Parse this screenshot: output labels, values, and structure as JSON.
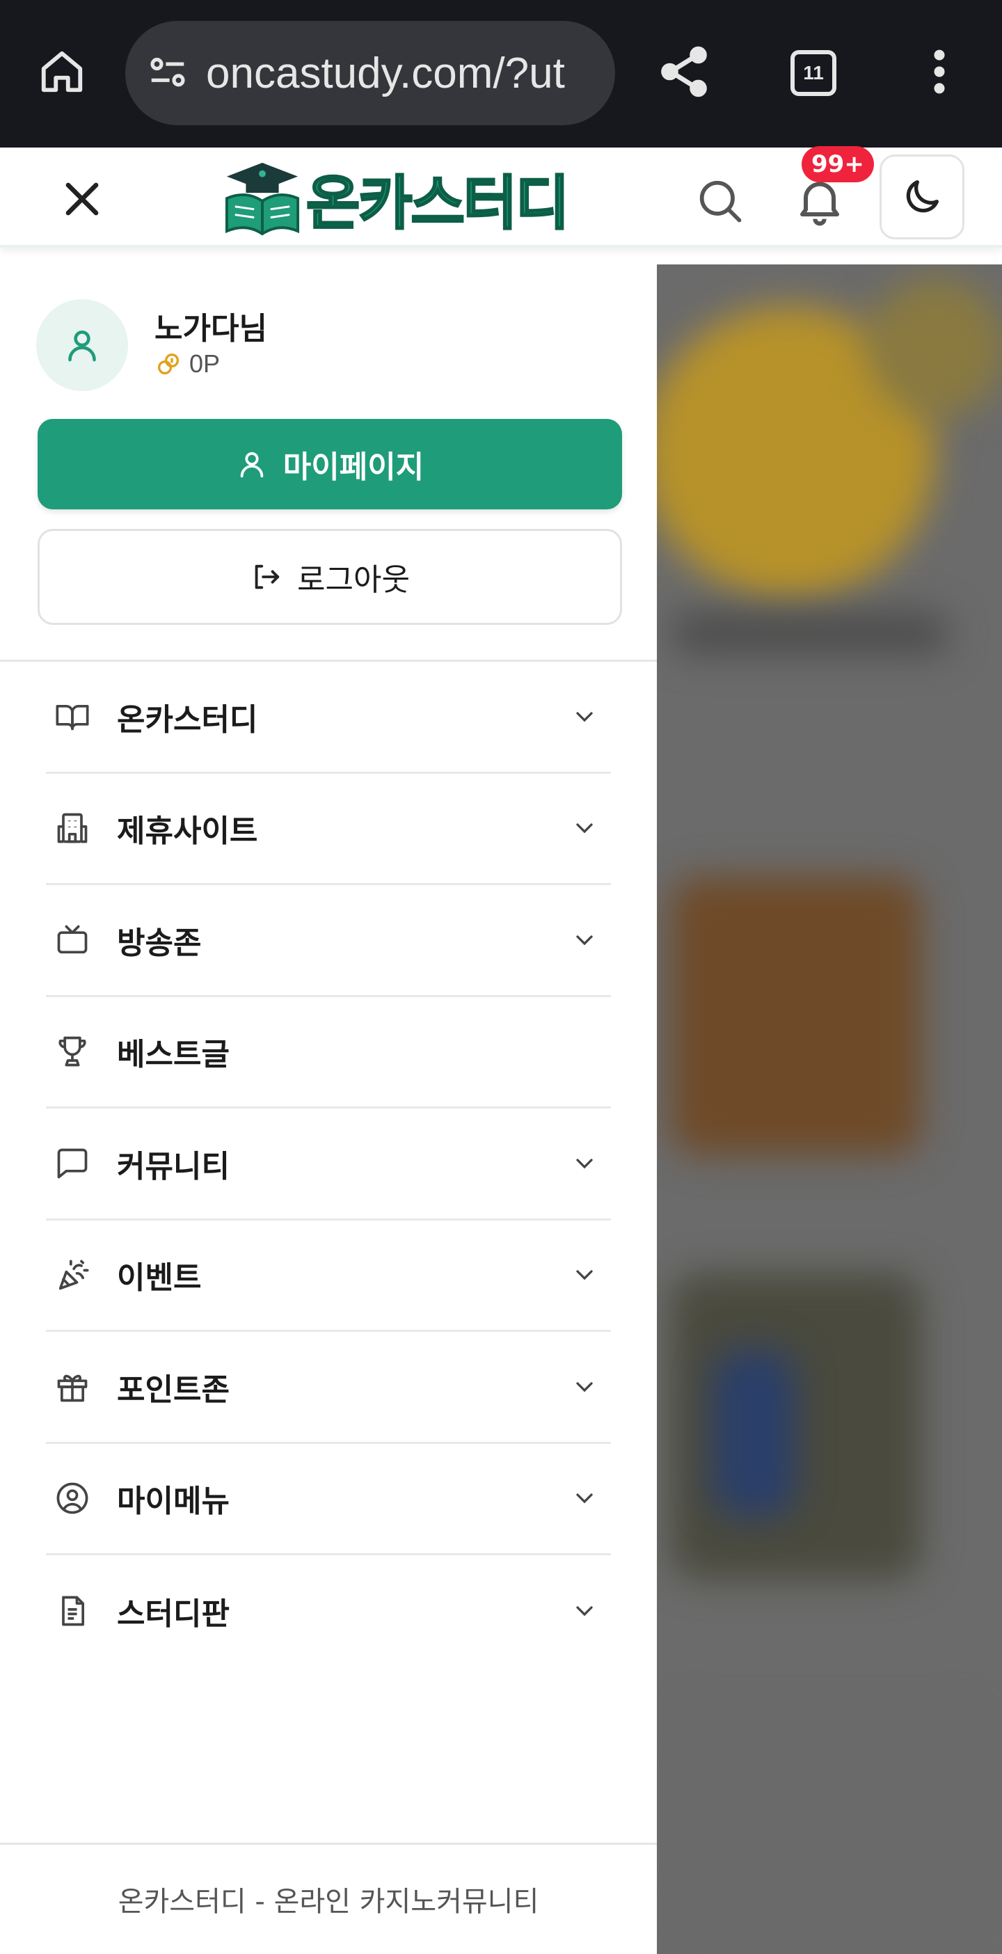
{
  "browser": {
    "url": "oncastudy.com/?ut",
    "tab_count": "11"
  },
  "header": {
    "logo_text": "온카스터디",
    "notification_badge": "99+"
  },
  "drawer": {
    "username": "노가다님",
    "points": "0P",
    "mypage_label": "마이페이지",
    "logout_label": "로그아웃",
    "menu": [
      {
        "label": "온카스터디",
        "icon": "book-icon",
        "expandable": true
      },
      {
        "label": "제휴사이트",
        "icon": "building-icon",
        "expandable": true
      },
      {
        "label": "방송존",
        "icon": "tv-icon",
        "expandable": true
      },
      {
        "label": "베스트글",
        "icon": "trophy-icon",
        "expandable": false
      },
      {
        "label": "커뮤니티",
        "icon": "chat-icon",
        "expandable": true
      },
      {
        "label": "이벤트",
        "icon": "party-popper-icon",
        "expandable": true
      },
      {
        "label": "포인트존",
        "icon": "gift-icon",
        "expandable": true
      },
      {
        "label": "마이메뉴",
        "icon": "user-circle-icon",
        "expandable": true
      },
      {
        "label": "스터디판",
        "icon": "document-icon",
        "expandable": true
      }
    ],
    "footer": "온카스터디 - 온라인 카지노커뮤니티"
  },
  "colors": {
    "accent": "#1f9c7a",
    "browser_bar": "#16181d",
    "badge": "#f0233d"
  }
}
